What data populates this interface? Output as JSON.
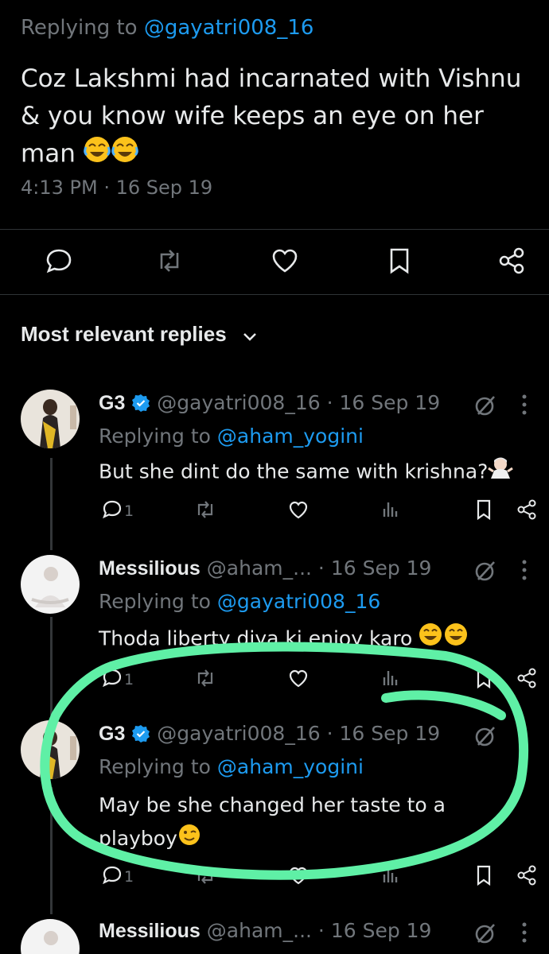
{
  "tweet": {
    "reply_prefix": "Replying to",
    "reply_handle": "@gayatri008_16",
    "text": "Coz Lakshmi had incarnated with Vishnu & you know wife keeps an eye on her man",
    "timestamp": "4:13 PM · 16 Sep 19",
    "actions": [
      "reply-icon",
      "retweet-icon",
      "like-icon",
      "bookmark-icon",
      "share-icon"
    ]
  },
  "replies_header": {
    "label": "Most relevant replies"
  },
  "replies": [
    {
      "name": "G3",
      "handle": "@gayatri008_16",
      "date": "· 16 Sep 19",
      "reply_prefix": "Replying to",
      "reply_handle": "@aham_yogini",
      "text": "But she dint do the same with krishna?",
      "reply_count": "1"
    },
    {
      "name": "Messilious",
      "handle": "@aham_...",
      "date": "· 16 Sep 19",
      "reply_prefix": "Replying to",
      "reply_handle": "@gayatri008_16",
      "text": "Thoda liberty diya ki enjoy karo",
      "reply_count": "1"
    },
    {
      "name": "G3",
      "handle": "@gayatri008_16",
      "date": "· 16 Sep 19",
      "reply_prefix": "Replying to",
      "reply_handle": "@aham_yogini",
      "text": "May be she changed her taste to a playboy",
      "reply_count": "1"
    },
    {
      "name": "Messilious",
      "handle": "@aham_...",
      "date": "· 16 Sep 19"
    }
  ],
  "colors": {
    "background": "#000000",
    "text": "#e7e9ea",
    "muted": "#71767b",
    "link": "#1d9bf0",
    "verified": "#1d9bf0",
    "annotation": "#5ff0a6"
  }
}
